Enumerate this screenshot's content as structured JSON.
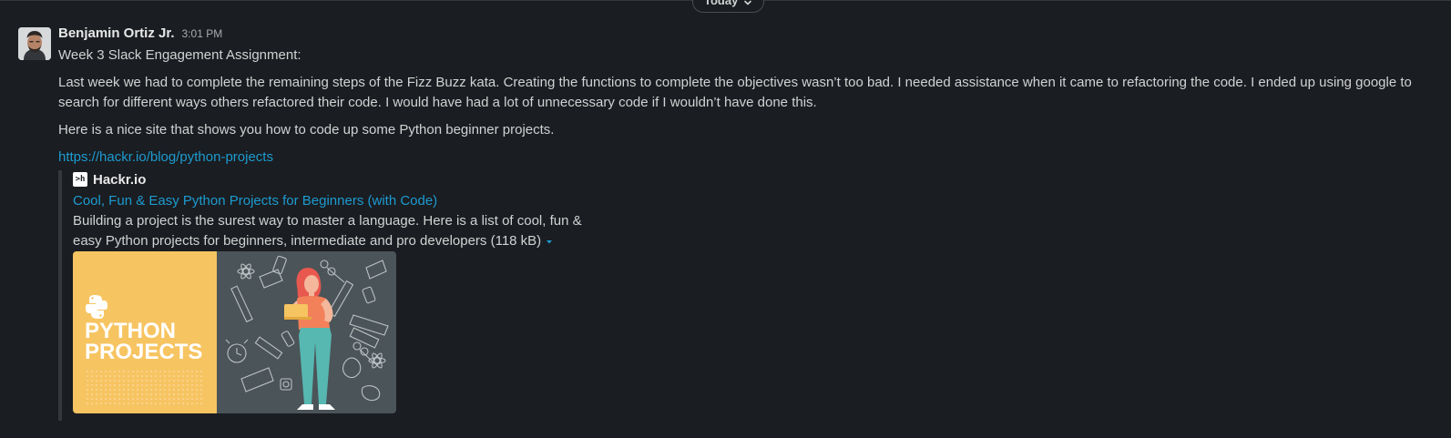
{
  "divider": {
    "label": "Today"
  },
  "message": {
    "author": "Benjamin Ortiz Jr.",
    "time": "3:01 PM",
    "lines": [
      "Week 3 Slack Engagement Assignment:",
      "Last week we had to complete the remaining steps of the Fizz Buzz kata. Creating the functions to complete the objectives wasn’t too bad. I needed assistance when it came to refactoring the code. I ended up using google to search for different ways others refactored their code. I would have had a lot of unnecessary code if I wouldn’t have done this.",
      "Here is a nice site that shows you how to code up some Python beginner projects."
    ],
    "link": "https://hackr.io/blog/python-projects"
  },
  "unfurl": {
    "site_icon_text": ">h",
    "site_name": "Hackr.io",
    "title": "Cool, Fun & Easy Python Projects for Beginners (with Code)",
    "description": "Building a project is the surest way to master a language. Here is a list of cool, fun & easy Python projects for beginners, intermediate and pro developers (118 kB)",
    "image": {
      "line1": "PYTHON",
      "line2": "PROJECTS"
    }
  },
  "colors": {
    "background": "#1a1d21",
    "link": "#1d9bd1",
    "text": "#d1d2d3",
    "image_yellow": "#f7c462",
    "image_slate": "#4b5458",
    "figure_hair": "#e8584f",
    "figure_pants": "#57b7b1"
  }
}
